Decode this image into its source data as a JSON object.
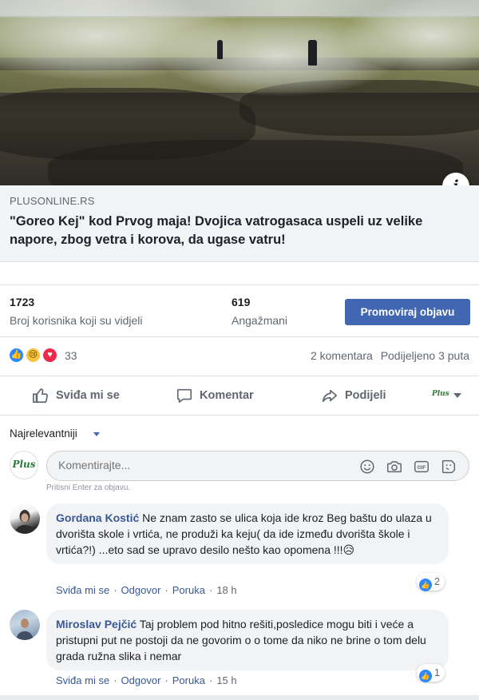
{
  "link_preview": {
    "domain": "PLUSONLINE.RS",
    "title": "\"Goreo Kej\" kod Prvog maja! Dvojica vatrogasaca uspeli uz velike napore, zbog vetra i korova, da ugase vatru!",
    "info_icon": "info-icon"
  },
  "stats": {
    "reach_value": "1723",
    "reach_label": "Broj korisnika koji su vidjeli",
    "engagement_value": "619",
    "engagement_label": "Angažmani",
    "promote_label": "Promoviraj objavu"
  },
  "reactions": {
    "count": "33",
    "comments": "2 komentara",
    "shares": "Podijeljeno 3 puta",
    "icons": [
      "like-icon",
      "sad-icon",
      "love-icon"
    ]
  },
  "actions": {
    "like_label": "Sviđa mi se",
    "comment_label": "Komentar",
    "share_label": "Podijeli"
  },
  "comments_section": {
    "sort_label": "Najrelevantniji",
    "composer_placeholder": "Komentirajte...",
    "composer_hint": "Pritisni Enter za objavu.",
    "page_logo_text": "Plus",
    "items": [
      {
        "author": "Gordana Kostić",
        "text": "Ne znam zasto se ulica koja ide kroz Beg baštu do ulaza u dvorišta skole i vrtića, ne produži ka keju( da ide između dvorišta škole i vrtića?!) ...eto sad se upravo desilo nešto kao opomena !!!😥",
        "likes": "2",
        "like_action": "Sviđa mi se",
        "reply_action": "Odgovor",
        "message_action": "Poruka",
        "time": "18 h"
      },
      {
        "author": "Miroslav Pejčić",
        "text": "Taj problem pod hitno rešiti,posledice mogu biti i veće a pristupni put ne postoji da ne govorim o o tome da niko ne brine o tom delu grada ružna slika i nemar",
        "likes": "1",
        "like_action": "Sviđa mi se",
        "reply_action": "Odgovor",
        "message_action": "Poruka",
        "time": "15 h"
      }
    ]
  },
  "colors": {
    "primary": "#4267b2",
    "link": "#385898",
    "secondary_text": "#606770",
    "bubble": "#f2f3f5"
  }
}
